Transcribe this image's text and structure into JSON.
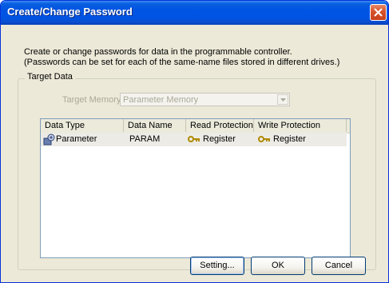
{
  "window": {
    "title": "Create/Change Password"
  },
  "description": {
    "line1": "Create or change passwords for data in the programmable controller.",
    "line2": "(Passwords can be set for each of the same-name files stored in different drives.)"
  },
  "target_data": {
    "group_label": "Target Data",
    "memory_label": "Target Memory",
    "memory_value": "Parameter Memory"
  },
  "table": {
    "columns": [
      "Data Type",
      "Data Name",
      "Read Protection",
      "Write Protection"
    ],
    "rows": [
      {
        "data_type": "Parameter",
        "data_name": "PARAM",
        "read_protection": "Register",
        "write_protection": "Register"
      }
    ]
  },
  "buttons": {
    "setting": "Setting...",
    "ok": "OK",
    "cancel": "Cancel"
  },
  "icons": {
    "close": "close-icon",
    "parameter": "parameter-icon",
    "key": "key-icon",
    "dropdown": "chevron-down-icon"
  }
}
